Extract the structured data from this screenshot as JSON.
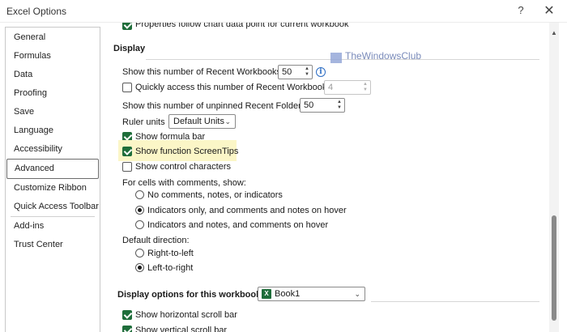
{
  "window": {
    "title": "Excel Options",
    "help_glyph": "?",
    "close_glyph": "✕"
  },
  "nav": {
    "items": [
      "General",
      "Formulas",
      "Data",
      "Proofing",
      "Save",
      "Language",
      "Accessibility",
      "Advanced",
      "Customize Ribbon",
      "Quick Access Toolbar",
      "Add-ins",
      "Trust Center"
    ],
    "active": "Advanced"
  },
  "top_partial_option": "Properties follow chart data point for current workbook",
  "display": {
    "heading": "Display",
    "recent_workbooks_label": "Show this number of Recent Workbooks:",
    "recent_workbooks_value": "50",
    "quick_access_label": "Quickly access this number of Recent Workbooks:",
    "quick_access_value": "4",
    "unpinned_folders_label": "Show this number of unpinned Recent Folders:",
    "unpinned_folders_value": "50",
    "ruler_label": "Ruler units",
    "ruler_value": "Default Units",
    "show_formula_bar": "Show formula bar",
    "show_screentips": "Show function ScreenTips",
    "show_control_chars": "Show control characters",
    "comments_label": "For cells with comments, show:",
    "comments_options": [
      "No comments, notes, or indicators",
      "Indicators only, and comments and notes on hover",
      "Indicators and notes, and comments on hover"
    ],
    "direction_label": "Default direction:",
    "direction_options": [
      "Right-to-left",
      "Left-to-right"
    ]
  },
  "workbook": {
    "heading": "Display options for this workbook:",
    "selected": "Book1",
    "horizontal_scroll": "Show horizontal scroll bar",
    "vertical_scroll": "Show vertical scroll bar"
  },
  "watermark": "TheWindowsClub",
  "colors": {
    "accent_green": "#1e6d3a",
    "highlight": "#fbf6c7",
    "info_blue": "#2b6cc4"
  }
}
